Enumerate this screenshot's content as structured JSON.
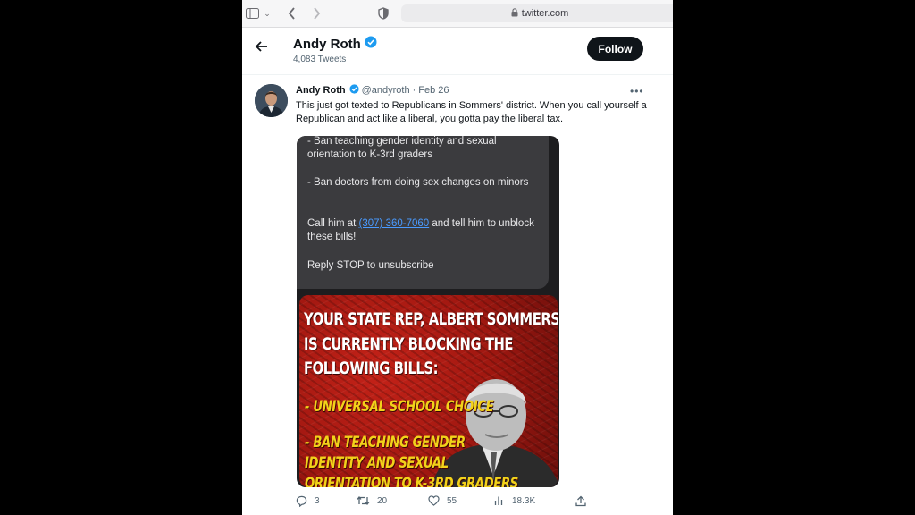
{
  "browser": {
    "url": "twitter.com",
    "icons": [
      "sidebar-icon",
      "chevron-down-icon",
      "back-icon",
      "forward-icon",
      "shield-icon",
      "lock-icon"
    ]
  },
  "profile": {
    "name": "Andy Roth",
    "tweet_count": "4,083 Tweets",
    "follow_label": "Follow"
  },
  "tweet": {
    "author": "Andy Roth",
    "handle": "@andyroth",
    "separator": "·",
    "date": "Feb 26",
    "text": "This just got texted to Republicans in Sommers' district.  When you call yourself a Republican and act like a liberal, you gotta pay the liberal tax.",
    "media": {
      "sms": {
        "line1": "- Ban teaching gender identity and sexual orientation to K-3rd graders",
        "line2": "- Ban doctors from doing sex changes on minors",
        "call_prefix": "Call him at",
        "phone": "(307) 360-7060",
        "call_suffix": "and tell him to unblock these bills!",
        "stop": "Reply STOP to unsubscribe"
      },
      "poster": {
        "headline1": "YOUR STATE REP, ALBERT SOMMERS,",
        "headline2": "IS CURRENTLY BLOCKING THE",
        "headline3": "FOLLOWING BILLS:",
        "bill1": "- UNIVERSAL SCHOOL CHOICE",
        "bill2a": "- BAN TEACHING GENDER",
        "bill2b": "IDENTITY AND SEXUAL",
        "bill2c": "ORIENTATION TO K-3RD GRADERS"
      }
    },
    "actions": {
      "replies": "3",
      "retweets": "20",
      "likes": "55",
      "views": "18.3K"
    }
  },
  "colors": {
    "verified": "#1d9bf0",
    "follow_bg": "#0f1419",
    "poster_red": "#b01c14",
    "poster_yellow": "#f2d21a",
    "link": "#4a9bff"
  }
}
